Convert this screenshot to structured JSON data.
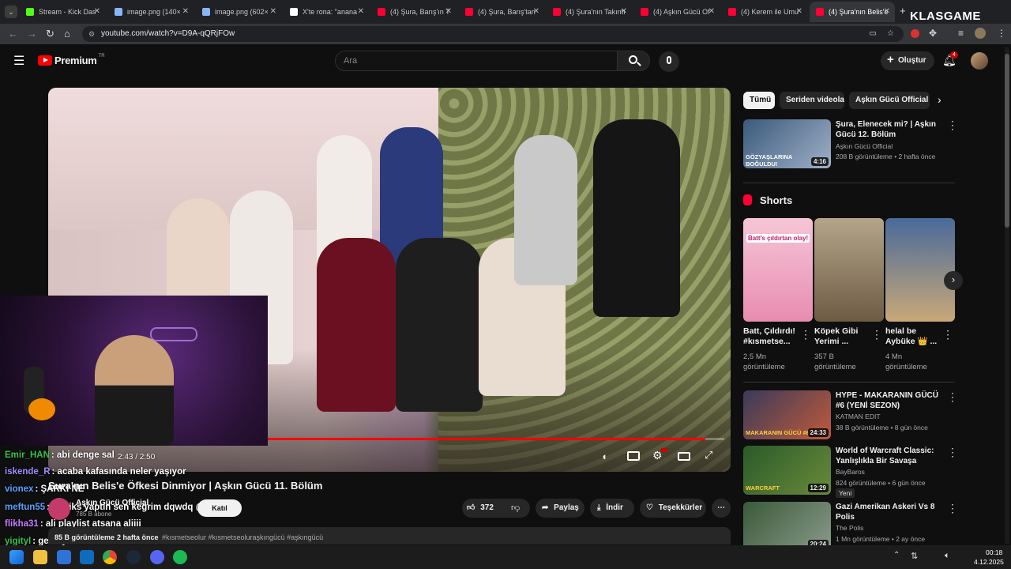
{
  "browser": {
    "tabs": [
      {
        "label": "Stream - Kick Das",
        "color": "#53fc18"
      },
      {
        "label": "image.png (140×",
        "color": "#8ab4f8"
      },
      {
        "label": "image.png (602×",
        "color": "#8ab4f8"
      },
      {
        "label": "X'te rona: \"anana",
        "color": "#ffffff"
      },
      {
        "label": "(4) Şura, Barış'ın T",
        "color": "#ff0033"
      },
      {
        "label": "(4) Şura, Barış'tan",
        "color": "#ff0033"
      },
      {
        "label": "(4) Şura'nın Takıntı",
        "color": "#ff0033"
      },
      {
        "label": "(4) Aşkın Gücü Of",
        "color": "#ff0033"
      },
      {
        "label": "(4) Kerem ile Umu",
        "color": "#ff0033"
      },
      {
        "label": "(4) Şura'nın Belis'e",
        "color": "#ff0033"
      }
    ],
    "new_tab": "+",
    "url": "youtube.com/watch?v=D9A-qQRjFOw",
    "overlay_brand": "KLASGAME"
  },
  "header": {
    "logo": "Premium",
    "logo_region": "TR",
    "search_placeholder": "Ara",
    "create_label": "Oluştur",
    "notif_count": "4"
  },
  "player": {
    "time": "2:43 / 2:50",
    "progress": 0.959
  },
  "video": {
    "title": "Şura'nın Belis'e Öfkesi Dinmiyor | Aşkın Gücü 11. Bölüm",
    "channel": "Aşkın Gücü Official",
    "subs": "785 B abone",
    "join_label": "Katıl",
    "likes": "372",
    "share_label": "Paylaş",
    "download_label": "İndir",
    "thanks_label": "Teşekkürler",
    "views": "85 B görüntüleme",
    "date": "2 hafta önce",
    "hashtags": "#kısmetseolur #kısmetseoluraşkıngücü #aşkıngücü"
  },
  "chat": [
    {
      "user": "Emir_HAN",
      "msg": ": abi denge sal",
      "color": "#35c24a"
    },
    {
      "user": "iskende_R",
      "msg": ": acaba kafasında neler yaşıyor",
      "color": "#a38bff"
    },
    {
      "user": "vionex",
      "msg": ": ŞARKI NE",
      "color": "#5aa0ff"
    },
    {
      "user": "meftun55",
      "msg": ": remiks yaptın sen kegrim dqwdq @hype_ol",
      "color": "#5aa0ff"
    },
    {
      "user": "flikha31",
      "msg": ": ali playlist atsana aliiii",
      "color": "#c77dff"
    },
    {
      "user": "yigityl",
      "msg": ": geldi yine belis",
      "color": "#35c24a"
    }
  ],
  "chips": [
    "Tümü",
    "Seriden videolar",
    "Aşkın Gücü Official a"
  ],
  "rec_top": {
    "title": "Şura, Elenecek mi? | Aşkın Gücü 12. Bölüm",
    "channel": "Aşkın Gücü Official",
    "meta": "208 B görüntüleme • 2 hafta önce",
    "duration": "4:16",
    "thumb_text": "GÖZYAŞLARINA BOĞULDU!"
  },
  "shorts": {
    "header": "Shorts",
    "items": [
      {
        "title": "Batt, Çıldırdı! #kısmetse...",
        "views": "2,5 Mn görüntüleme",
        "thumb_text": "Batt's çıldırtan olay!"
      },
      {
        "title": "Köpek Gibi Yerimi ...",
        "views": "357 B görüntüleme"
      },
      {
        "title": "helal be Aybüke 👑 ...",
        "views": "4 Mn görüntüleme"
      }
    ]
  },
  "recs": [
    {
      "title": "HYPE - MAKARANIN GÜCÜ #6 (YENİ SEZON)",
      "channel": "KATMAN EDIT",
      "meta": "38 B görüntüleme • 8 gün önce",
      "duration": "24:33",
      "thumb_text": "MAKARANIN GÜCÜ #6"
    },
    {
      "title": "World of Warcraft Classic: Yanlışlıkla Bir Savaşa Katıldım",
      "channel": "BayBaros",
      "meta": "824 görüntüleme • 6 gün önce",
      "duration": "12:29",
      "badge": "Yeni",
      "thumb_text": "WARCRAFT"
    },
    {
      "title": "Gazi Amerikan Askeri Vs 8 Polis",
      "channel": "The Polis",
      "meta": "1 Mn görüntüleme • 2 ay önce",
      "duration": "20:24"
    }
  ],
  "taskbar": {
    "time": "00:18",
    "date": "4.12.2025"
  }
}
